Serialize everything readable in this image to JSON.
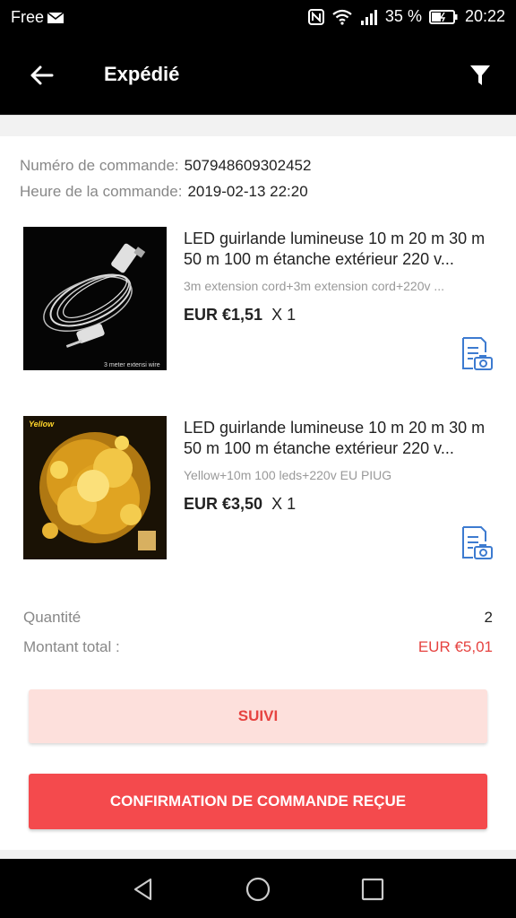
{
  "status_bar": {
    "carrier": "Free",
    "battery": "35 %",
    "time": "20:22"
  },
  "header": {
    "title": "Expédié"
  },
  "order": {
    "number_label": "Numéro de commande:",
    "number_value": "507948609302452",
    "time_label": "Heure de la commande:",
    "time_value": "2019-02-13 22:20"
  },
  "items": [
    {
      "name": "LED guirlande lumineuse 10 m 20 m 30 m 50 m 100 m étanche extérieur 220 v...",
      "sku": "3m extension cord+3m extension cord+220v ...",
      "price": "EUR €1,51",
      "qty": "X 1",
      "image_caption": "3 meter extensi wire"
    },
    {
      "name": "LED guirlande lumineuse 10 m 20 m 30 m 50 m 100 m étanche extérieur 220 v...",
      "sku": "Yellow+10m 100 leds+220v EU PIUG",
      "price": "EUR €3,50",
      "qty": "X 1",
      "image_caption": "Yellow"
    }
  ],
  "summary": {
    "quantity_label": "Quantité",
    "quantity_value": "2",
    "total_label": "Montant total :",
    "total_value": "EUR €5,01"
  },
  "buttons": {
    "track": "SUIVI",
    "confirm": "CONFIRMATION DE COMMANDE REÇUE"
  },
  "colors": {
    "accent": "#f44a4d",
    "track_bg": "#fde0dc",
    "icon_blue": "#3d7bd0"
  }
}
